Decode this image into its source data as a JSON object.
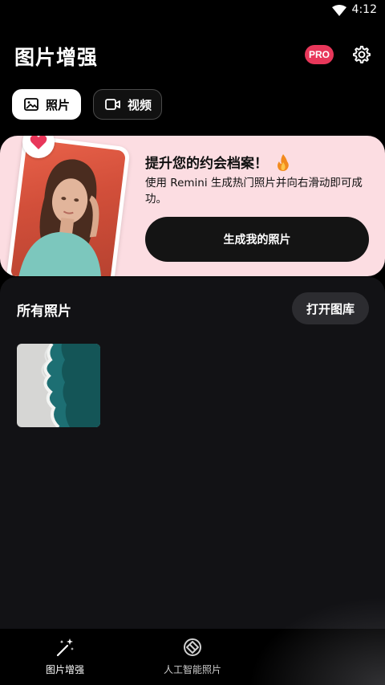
{
  "status_bar": {
    "time": "4:12"
  },
  "header": {
    "title": "图片增强",
    "pro_badge": "PRO"
  },
  "tabs": [
    {
      "label": "照片",
      "icon": "image-icon",
      "active": true
    },
    {
      "label": "视频",
      "icon": "video-icon",
      "active": false
    }
  ],
  "promo": {
    "title": "提升您的约会档案！",
    "description": "使用 Remini 生成热门照片并向右滑动即可成功。",
    "button_label": "生成我的照片",
    "accent_color": "#fcdde2",
    "heart_color": "#e8375a"
  },
  "gallery": {
    "title": "所有照片",
    "open_button_label": "打开图库"
  },
  "bottom_nav": [
    {
      "label": "图片增强",
      "icon": "magic-wand-icon"
    },
    {
      "label": "人工智能照片",
      "icon": "ai-logo-icon"
    }
  ],
  "colors": {
    "pro": "#e8375a",
    "background": "#121215"
  }
}
